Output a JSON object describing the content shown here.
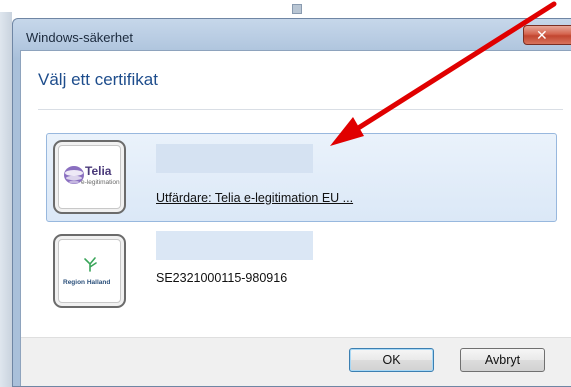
{
  "window": {
    "title": "Windows-säkerhet",
    "close_glyph": "✕"
  },
  "dialog": {
    "heading": "Välj ett certifikat"
  },
  "certificates": [
    {
      "issuer_logo_text": "Telia",
      "issuer_logo_subtext": "e-legitimation",
      "subtitle": "Utfärdare: Telia e-legitimation EU ...",
      "selected": true
    },
    {
      "issuer_logo_text": "Region Halland",
      "subtitle": "SE2321000115-980916",
      "selected": false
    }
  ],
  "buttons": {
    "ok_label": "OK",
    "cancel_label": "Avbryt"
  },
  "annotation": {
    "arrow_color": "#e00000"
  },
  "colors": {
    "heading": "#1e4d8c",
    "selection_border": "#98b8de",
    "close_button": "#c24630"
  }
}
